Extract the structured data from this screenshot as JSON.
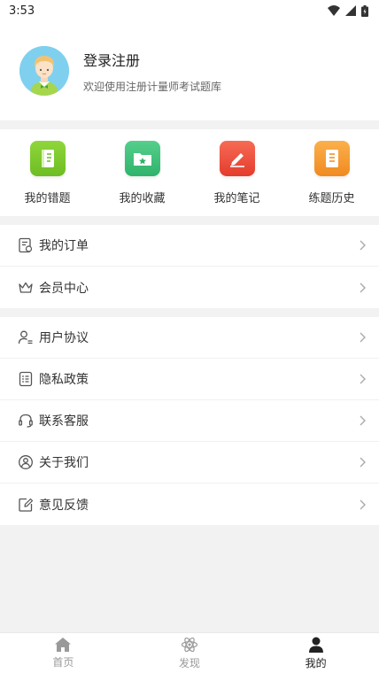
{
  "status_bar": {
    "time": "3:53"
  },
  "profile": {
    "title": "登录注册",
    "subtitle": "欢迎使用注册计量师考试题库"
  },
  "shortcuts": [
    {
      "label": "我的错题",
      "color": "#7ccb2b"
    },
    {
      "label": "我的收藏",
      "color": "#3dbf7a"
    },
    {
      "label": "我的笔记",
      "color": "#ef4b3a"
    },
    {
      "label": "练题历史",
      "color": "#f59b2c"
    }
  ],
  "group1": [
    {
      "label": "我的订单",
      "icon": "order-icon"
    },
    {
      "label": "会员中心",
      "icon": "crown-icon"
    }
  ],
  "group2": [
    {
      "label": "用户协议",
      "icon": "user-agreement-icon"
    },
    {
      "label": "隐私政策",
      "icon": "privacy-icon"
    },
    {
      "label": "联系客服",
      "icon": "headset-icon"
    },
    {
      "label": "关于我们",
      "icon": "about-icon"
    },
    {
      "label": "意见反馈",
      "icon": "feedback-icon"
    }
  ],
  "tabbar": [
    {
      "label": "首页",
      "icon": "home-icon"
    },
    {
      "label": "发现",
      "icon": "atom-icon"
    },
    {
      "label": "我的",
      "icon": "person-icon",
      "active": true
    }
  ],
  "colors": {
    "active_tab": "#222222",
    "inactive_tab": "#999999",
    "icon_stroke": "#555555",
    "chevron": "#aaaaaa"
  }
}
